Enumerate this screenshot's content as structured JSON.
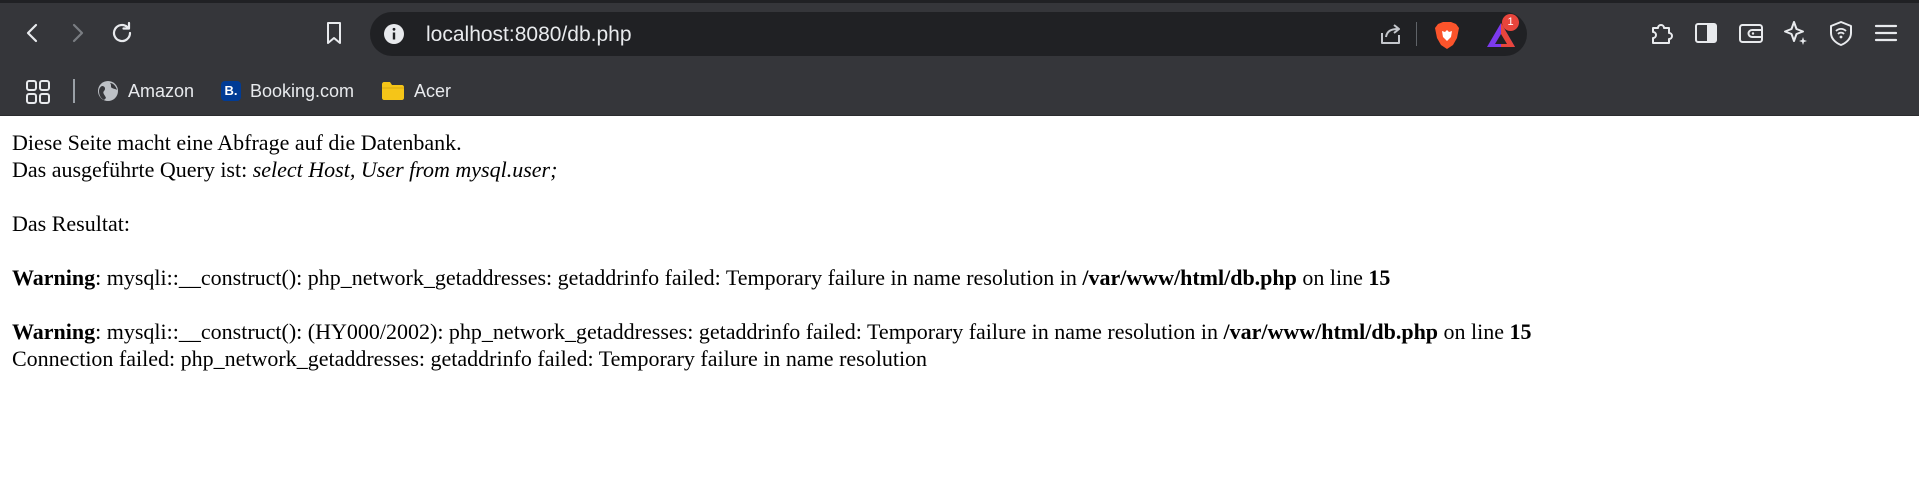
{
  "browser": {
    "url": "localhost:8080/db.php",
    "notification_count": "1",
    "bookmarks": [
      {
        "label": "Amazon"
      },
      {
        "label": "Booking.com",
        "icon_text": "B."
      },
      {
        "label": "Acer"
      }
    ]
  },
  "page": {
    "intro_line": "Diese Seite macht eine Abfrage auf die Datenbank.",
    "query_prefix": "Das ausgeführte Query ist: ",
    "query": "select Host, User from mysql.user;",
    "result_label": "Das Resultat:",
    "warnings": [
      {
        "label": "Warning",
        "message": ": mysqli::__construct(): php_network_getaddresses: getaddrinfo failed: Temporary failure in name resolution in ",
        "file": "/var/www/html/db.php",
        "on_line_text": " on line ",
        "line": "15"
      },
      {
        "label": "Warning",
        "message": ": mysqli::__construct(): (HY000/2002): php_network_getaddresses: getaddrinfo failed: Temporary failure in name resolution in ",
        "file": "/var/www/html/db.php",
        "on_line_text": " on line ",
        "line": "15"
      }
    ],
    "connection_error": "Connection failed: php_network_getaddresses: getaddrinfo failed: Temporary failure in name resolution"
  },
  "icons": {
    "back": "back-icon",
    "forward": "forward-icon",
    "reload": "reload-icon",
    "bookmark": "bookmark-icon",
    "info": "info-icon",
    "share": "share-icon",
    "brave_shields": "brave-lion-icon",
    "rewards": "brave-rewards-icon",
    "extensions": "extensions-icon",
    "sidebar": "sidebar-icon",
    "wallet": "wallet-icon",
    "leo": "leo-ai-icon",
    "vpn": "vpn-icon",
    "menu": "menu-icon",
    "apps": "apps-grid-icon",
    "globe": "globe-icon",
    "folder": "folder-icon"
  },
  "colors": {
    "toolbar_bg": "#35363a",
    "omnibox_bg": "#202124",
    "toolbar_text": "#e8eaed",
    "brave_orange": "#fb542b",
    "folder_yellow": "#f5c518"
  }
}
